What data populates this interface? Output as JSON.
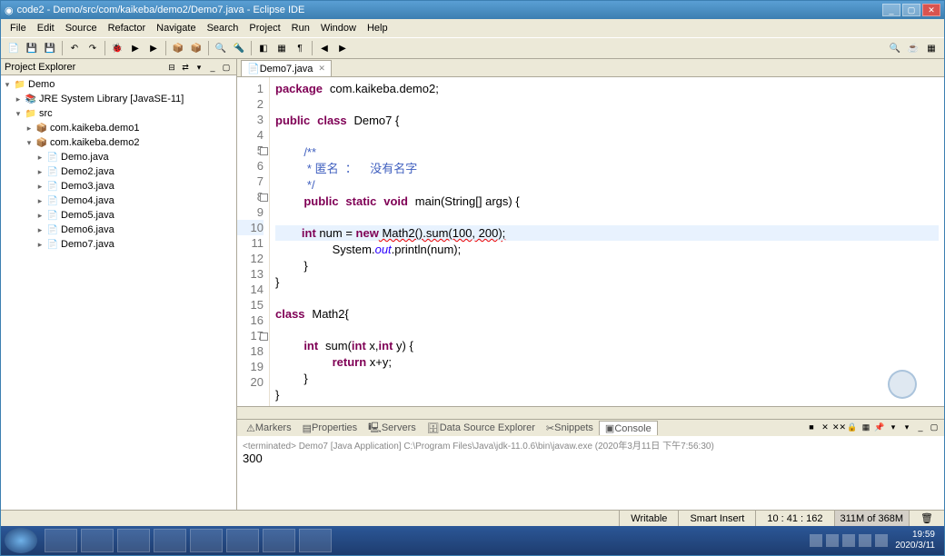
{
  "title": "code2 - Demo/src/com/kaikeba/demo2/Demo7.java - Eclipse IDE",
  "menu": [
    "File",
    "Edit",
    "Source",
    "Refactor",
    "Navigate",
    "Search",
    "Project",
    "Run",
    "Window",
    "Help"
  ],
  "explorer": {
    "title": "Project Explorer",
    "project": "Demo",
    "jre": "JRE System Library [JavaSE-11]",
    "src": "src",
    "pkg1": "com.kaikeba.demo1",
    "pkg2": "com.kaikeba.demo2",
    "files": [
      "Demo.java",
      "Demo2.java",
      "Demo3.java",
      "Demo4.java",
      "Demo5.java",
      "Demo6.java",
      "Demo7.java"
    ]
  },
  "tab": {
    "label": "Demo7.java"
  },
  "code": {
    "lines": [
      1,
      2,
      3,
      4,
      5,
      6,
      7,
      8,
      9,
      10,
      11,
      12,
      13,
      14,
      15,
      16,
      17,
      18,
      19,
      20
    ],
    "pkg": "package",
    "pkgname": "com.kaikeba.demo2;",
    "pub": "public",
    "cls": "class",
    "clsname": "Demo7 {",
    "doc1": "/**",
    "doc2": " * 匿名  ：    没有名字",
    "doc3": " */",
    "static": "static",
    "void": "void",
    "main": "main(String[] args) {",
    "int": "int",
    "num": "num = ",
    "new": "new",
    "call": " Math2().sum(100, 200);",
    "sysout": "System.",
    "out": "out",
    "println": ".println(num);",
    "rb": "}",
    "cls2": "Math2{",
    "sum": "sum(",
    "x": " x,",
    "y": " y) {",
    "ret": "return",
    "xy": " x+y;"
  },
  "console": {
    "tabs": [
      "Markers",
      "Properties",
      "Servers",
      "Data Source Explorer",
      "Snippets",
      "Console"
    ],
    "launch": "<terminated> Demo7 [Java Application] C:\\Program Files\\Java\\jdk-11.0.6\\bin\\javaw.exe (2020年3月11日 下午7:56:30)",
    "output": "300"
  },
  "status": {
    "writable": "Writable",
    "insert": "Smart Insert",
    "pos": "10 : 41 : 162",
    "mem": "311M of 368M"
  },
  "tray": {
    "time": "19:59",
    "date": "2020/3/11"
  }
}
